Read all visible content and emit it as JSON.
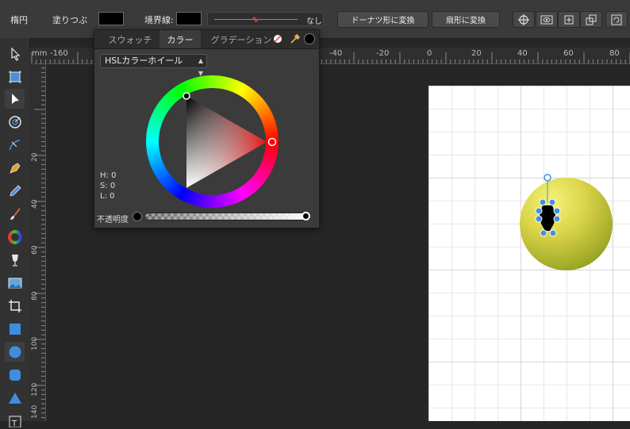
{
  "toolbar": {
    "shape_label": "楕円",
    "fill_label": "塗りつぶ",
    "stroke_label": "境界線:",
    "stroke_width_value": "なし",
    "donut_button": "ドーナツ形に変換",
    "pie_button": "扇形に変換",
    "fill_color": "#000000",
    "stroke_color": "#000000"
  },
  "ruler": {
    "unit": "mm",
    "h_ticks": [
      "-160",
      "-40",
      "-20",
      "0",
      "20",
      "40",
      "60",
      "80"
    ],
    "v_ticks": [
      "20",
      "40",
      "60",
      "80",
      "100",
      "120",
      "140"
    ]
  },
  "color_panel": {
    "tabs": [
      "スウォッチ",
      "カラー",
      "グラデーション"
    ],
    "active_tab": "カラー",
    "mode": "HSLカラーホイール",
    "h": "H: 0",
    "s": "S: 0",
    "l": "L: 0",
    "opacity_label": "不透明度",
    "selected_color": "#000000"
  },
  "tools": [
    "move-tool",
    "artboard-tool",
    "node-tool",
    "corner-tool",
    "point-transform-tool",
    "pen-tool",
    "pencil-tool",
    "vector-brush-tool",
    "fill-tool",
    "transparency-tool",
    "place-image-tool",
    "crop-tool",
    "rectangle-tool",
    "ellipse-tool",
    "rounded-rectangle-tool",
    "triangle-tool",
    "text-frame-tool"
  ]
}
